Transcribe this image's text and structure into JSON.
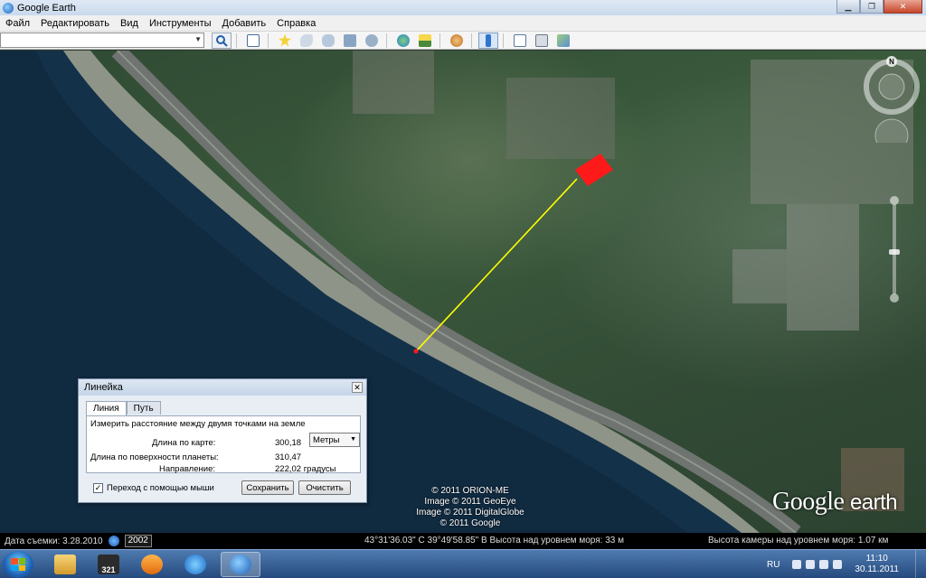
{
  "window": {
    "title": "Google Earth"
  },
  "menu": [
    "Файл",
    "Редактировать",
    "Вид",
    "Инструменты",
    "Добавить",
    "Справка"
  ],
  "search": {
    "value": "",
    "placeholder": ""
  },
  "map": {
    "credits": [
      "© 2011 ORION-ME",
      "Image © 2011 GeoEye",
      "Image © 2011 DigitalGlobe",
      "© 2011 Google"
    ],
    "logo_main": "Google",
    "logo_sub": "earth",
    "compass_north": "N",
    "measure_line_color": "#ffff00",
    "marker_color": "#ff1a1a"
  },
  "ruler": {
    "title": "Линейка",
    "tabs": [
      "Линия",
      "Путь"
    ],
    "description": "Измерить расстояние между двумя точками на земле",
    "map_length_label": "Длина по карте:",
    "map_length_value": "300,18",
    "units": "Метры",
    "ground_length_label": "Длина по поверхности планеты:",
    "ground_length_value": "310,47",
    "heading_label": "Направление:",
    "heading_value": "222,02 градусы",
    "mouse_nav_label": "Переход с помощью мыши",
    "mouse_nav_checked": true,
    "save_label": "Сохранить",
    "clear_label": "Очистить"
  },
  "status": {
    "imagery_date": "Дата съемки: 3.28.2010",
    "year": "2002",
    "coords": "43°31'36.03\" С  39°49'58.85\" В  Высота над уровнем моря:   33 м",
    "eye_alt": "Высота камеры над уровнем моря:   1.07 км"
  },
  "taskbar": {
    "lang": "RU",
    "time": "11:10",
    "date": "30.11.2011",
    "pinned_badge": "321"
  }
}
